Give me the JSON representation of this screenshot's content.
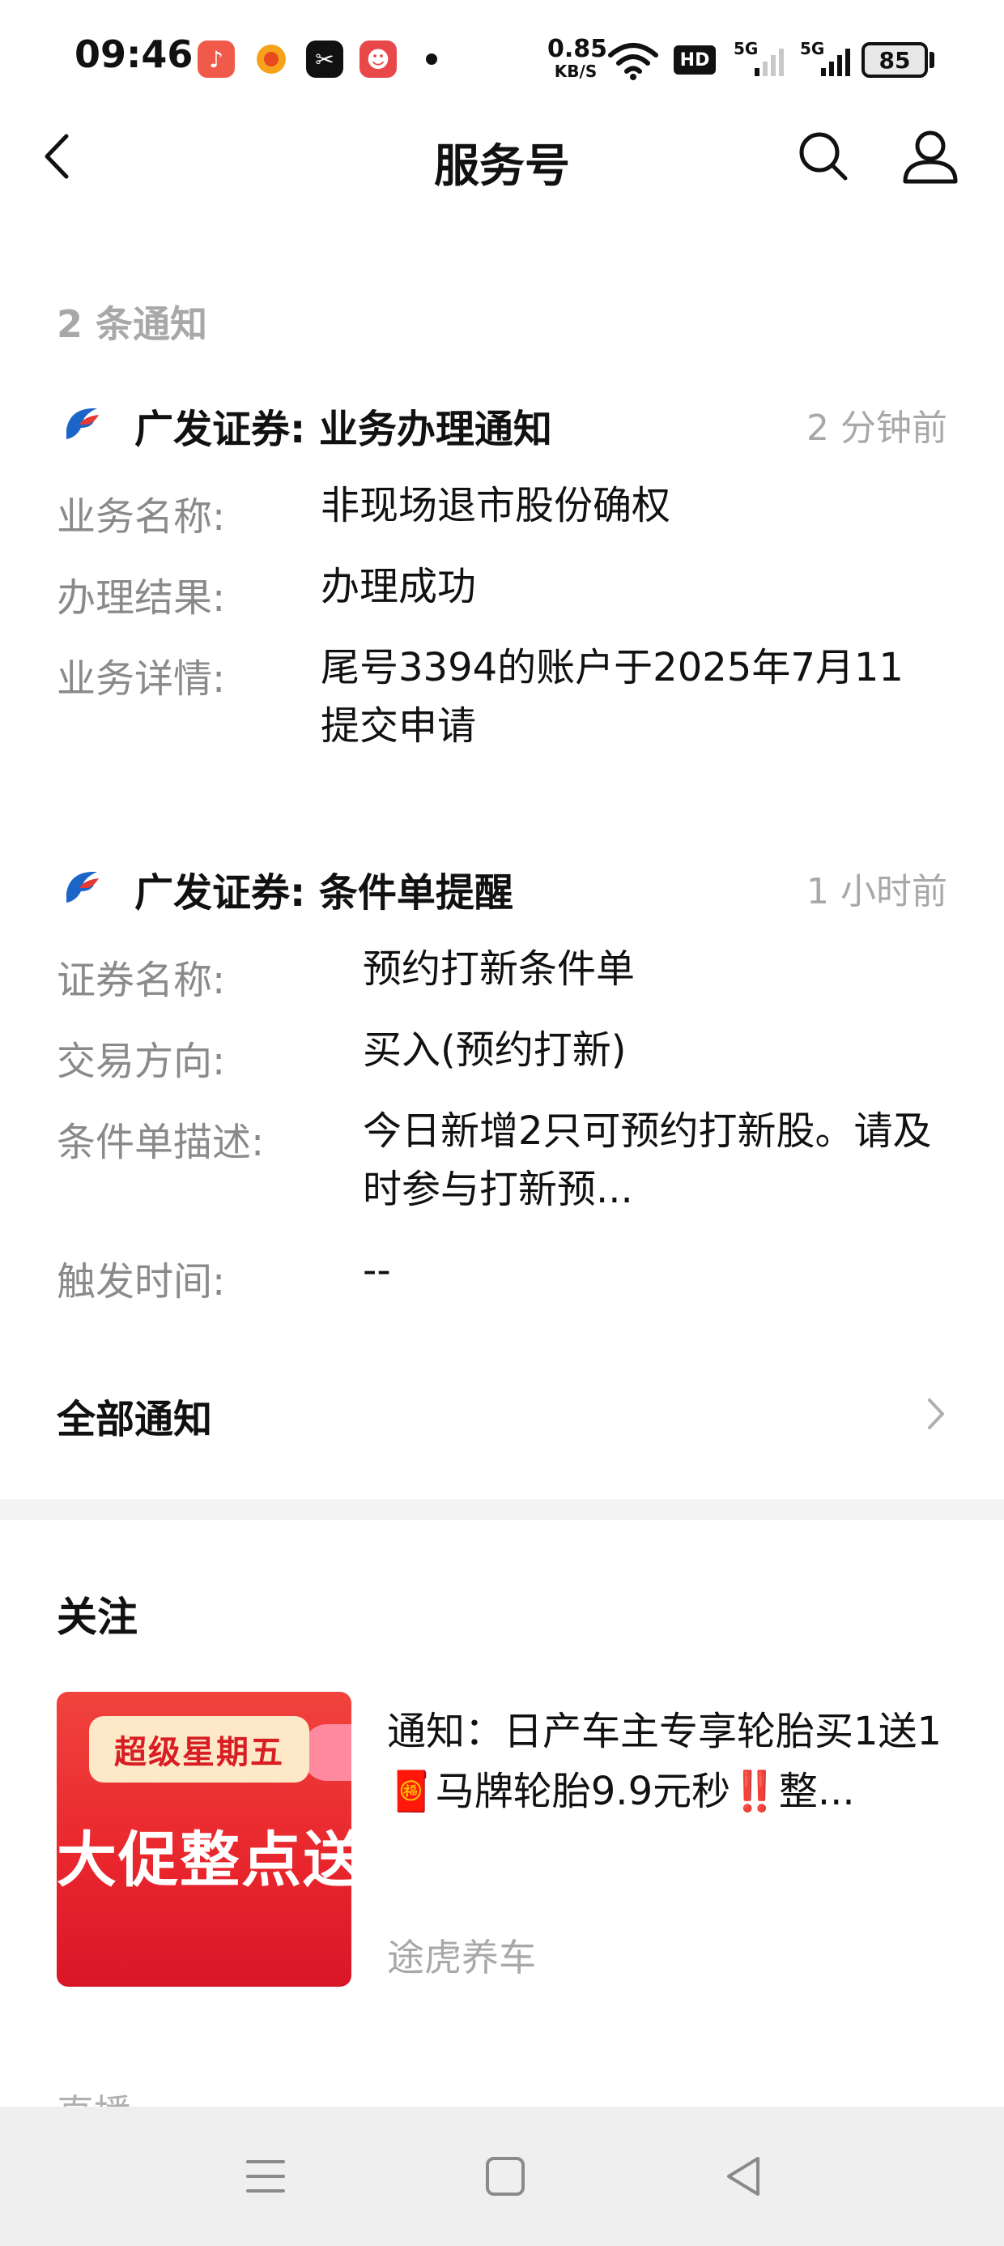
{
  "status_bar": {
    "time": "09:46",
    "net_speed_value": "0.85",
    "net_speed_unit": "KB/S",
    "hd_label": "HD",
    "signal_1_label": "5G",
    "signal_2_label": "5G",
    "battery": "85"
  },
  "header": {
    "title": "服务号",
    "back_icon": "chevron-left-icon",
    "search_icon": "search-icon",
    "profile_icon": "user-icon"
  },
  "notifications": {
    "count_label": "2 条通知",
    "items": [
      {
        "sender": "广发证券:",
        "title": "业务办理通知",
        "time": "2 分钟前",
        "fields": [
          {
            "label": "业务名称:",
            "value": "非现场退市股份确权"
          },
          {
            "label": "办理结果:",
            "value": "办理成功"
          },
          {
            "label": "业务详情:",
            "value": "尾号3394的账户于2025年7月11提交申请"
          }
        ]
      },
      {
        "sender": "广发证券:",
        "title": "条件单提醒",
        "time": "1 小时前",
        "fields": [
          {
            "label": "证券名称:",
            "value": "预约打新条件单"
          },
          {
            "label": "交易方向:",
            "value": "买入(预约打新)"
          },
          {
            "label": "条件单描述:",
            "value": "今日新增2只可预约打新股。请及时参与打新预..."
          },
          {
            "label": "触发时间:",
            "value": "--"
          }
        ]
      }
    ],
    "all_label": "全部通知"
  },
  "following": {
    "label": "关注",
    "card": {
      "thumb_tag": "超级星期五",
      "thumb_big_text": "大促整点送",
      "text": "通知：日产车主专享轮胎买1送1🧧马牌轮胎9.9元秒‼️整...",
      "source": "途虎养车"
    }
  },
  "next_section_label": "直播",
  "colors": {
    "accent_red": "#e8252c",
    "muted_gray": "#a8a8a8",
    "logo_blue": "#1b64c8",
    "logo_red": "#e53935"
  }
}
